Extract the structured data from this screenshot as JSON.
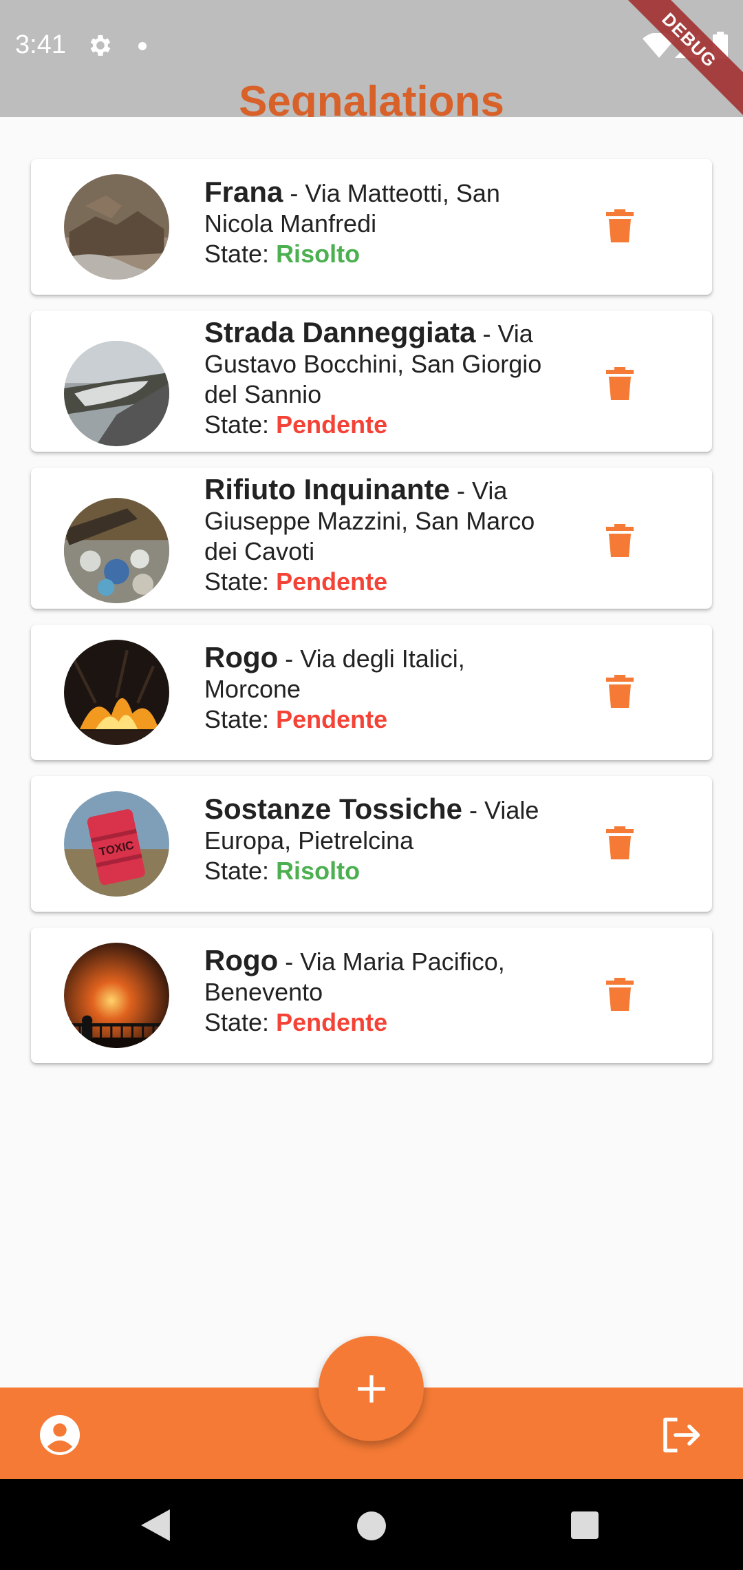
{
  "status_bar": {
    "time": "3:41",
    "debug_label": "DEBUG"
  },
  "app_bar": {
    "title": "Segnalations"
  },
  "state_prefix": "State: ",
  "reports": [
    {
      "title": "Frana",
      "separator": " - ",
      "address": "Via Matteotti, San Nicola Manfredi",
      "state": "Risolto",
      "state_kind": "ok",
      "image": "debris-photo"
    },
    {
      "title": "Strada Danneggiata",
      "separator": " - ",
      "address": "Via Gustavo Bocchini, San Giorgio del Sannio",
      "state": "Pendente",
      "state_kind": "pending",
      "image": "damaged-road-photo"
    },
    {
      "title": "Rifiuto Inquinante",
      "separator": " - ",
      "address": "Via Giuseppe Mazzini, San Marco dei Cavoti",
      "state": "Pendente",
      "state_kind": "pending",
      "image": "garbage-photo"
    },
    {
      "title": "Rogo",
      "separator": " - ",
      "address": "Via degli Italici, Morcone",
      "state": "Pendente",
      "state_kind": "pending",
      "image": "fire-photo"
    },
    {
      "title": "Sostanze Tossiche",
      "separator": " - ",
      "address": "Viale Europa, Pietrelcina",
      "state": "Risolto",
      "state_kind": "ok",
      "image": "toxic-barrel-photo",
      "barrel_text": "TOXIC"
    },
    {
      "title": "Rogo",
      "separator": " - ",
      "address": "Via Maria Pacifico, Benevento",
      "state": "Pendente",
      "state_kind": "pending",
      "image": "night-fire-photo"
    }
  ],
  "colors": {
    "accent": "#f47a35",
    "title": "#d8612a",
    "resolved": "#4caf50",
    "pending": "#f44336"
  },
  "icons": {
    "delete": "trash-icon",
    "add": "plus-icon",
    "account": "account-circle-icon",
    "logout": "logout-icon"
  }
}
